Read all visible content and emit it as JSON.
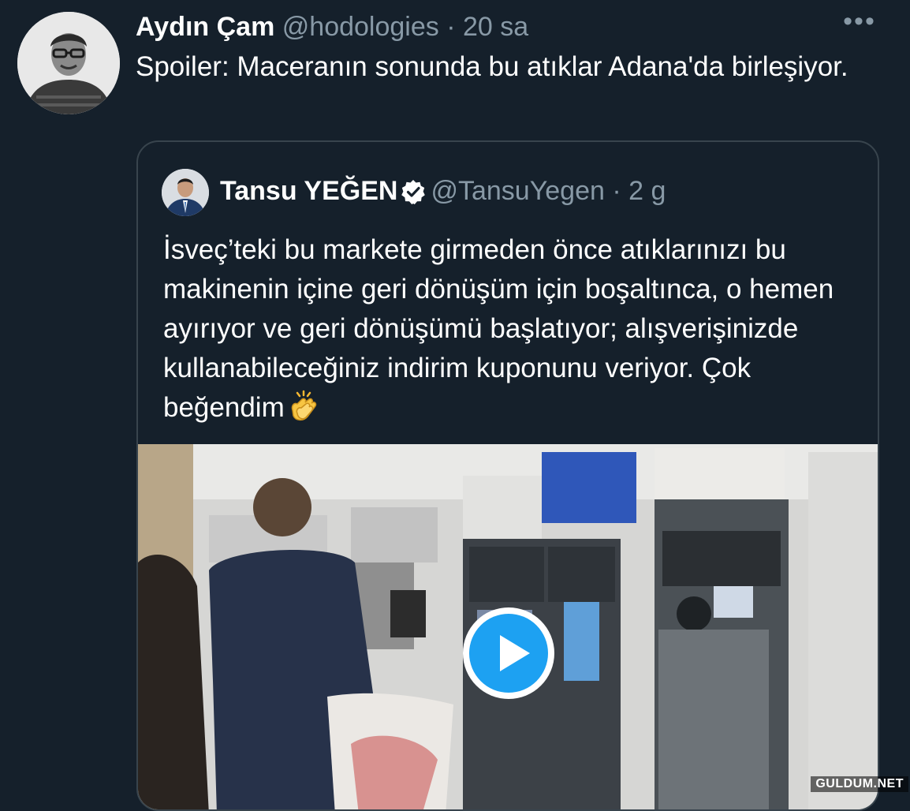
{
  "tweet": {
    "author_name": "Aydın Çam",
    "handle": "@hodologies",
    "separator": "·",
    "time": "20 sa",
    "more_icon": "more-horizontal-icon",
    "more_glyph": "•••",
    "text": "Spoiler: Maceranın sonunda bu atıklar Adana'da birleşiyor."
  },
  "quote": {
    "author_name": "Tansu YEĞEN",
    "handle": "@TansuYegen",
    "separator": "·",
    "time": "2 g",
    "verified_icon": "verified-badge-icon",
    "text": "İsveç’teki bu markete girmeden önce atıklarınızı bu makinenin içine geri dönüşüm için boşaltınca, o hemen ayırıyor ve geri dönüşümü başlatıyor; alışverişinizde kullanabileceğiniz indirim kuponunu veriyor. Çok beğendim",
    "emoji": "clapping-hands-icon",
    "media": {
      "type": "video",
      "play_icon": "play-button-icon"
    }
  },
  "watermark": "GULDUM.NET",
  "colors": {
    "background": "#15202b",
    "text": "#ffffff",
    "muted": "#8899a6",
    "border": "#38444d",
    "accent": "#1da1f2"
  }
}
